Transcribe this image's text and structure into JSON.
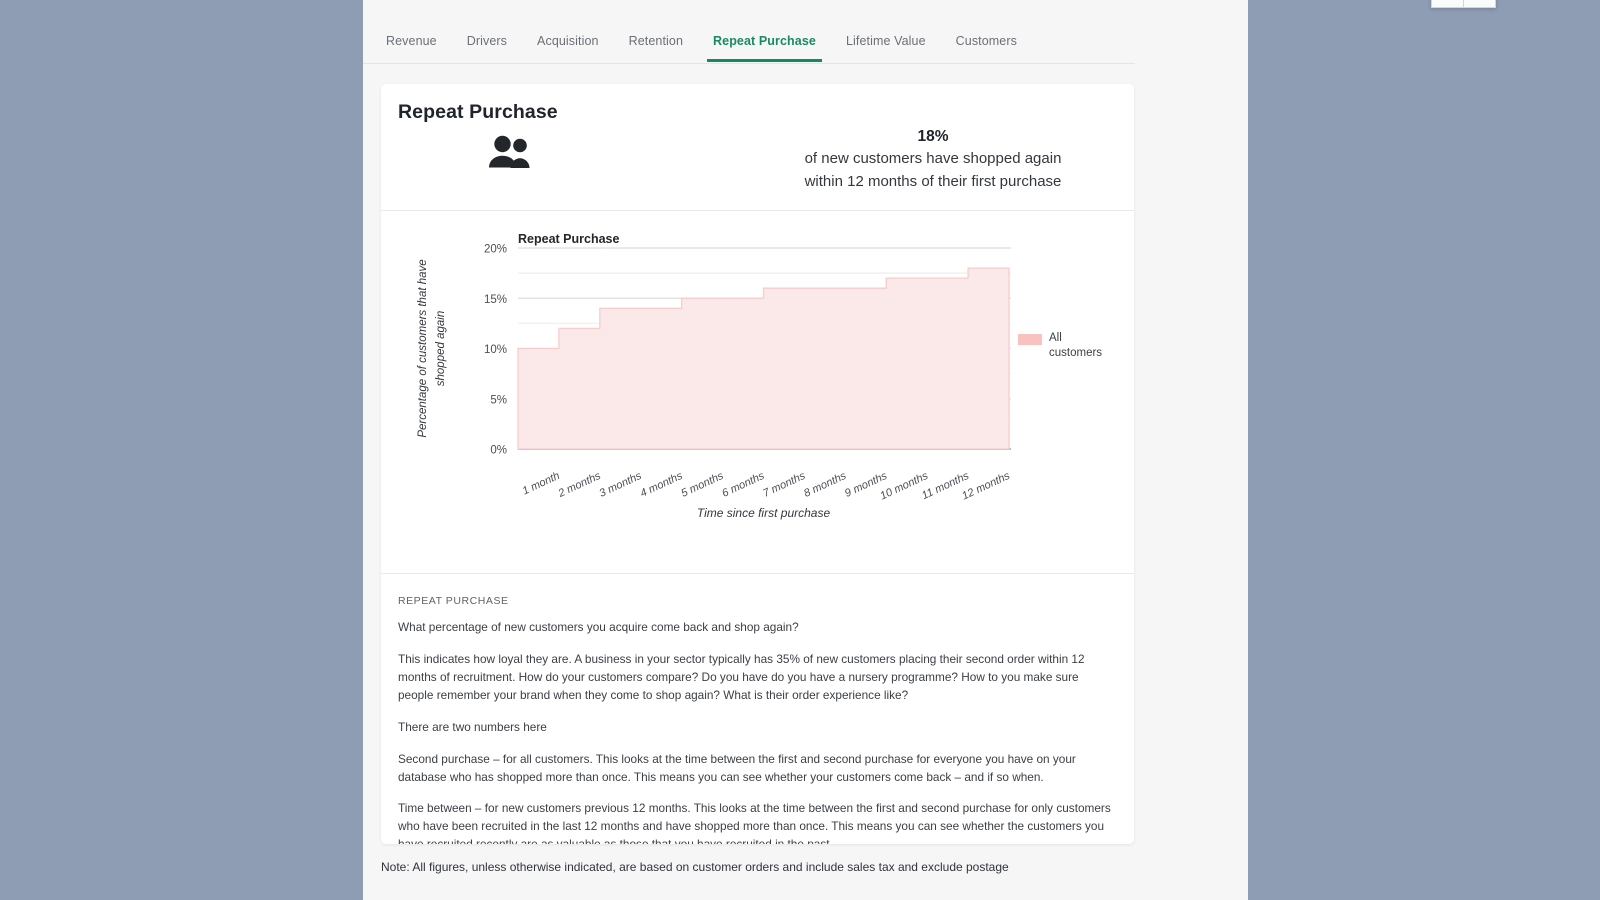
{
  "window": {
    "chrome_buttons": [
      "minimize-restore",
      "close"
    ]
  },
  "tabs": [
    {
      "label": "Revenue",
      "active": false
    },
    {
      "label": "Drivers",
      "active": false
    },
    {
      "label": "Acquisition",
      "active": false
    },
    {
      "label": "Retention",
      "active": false
    },
    {
      "label": "Repeat Purchase",
      "active": true
    },
    {
      "label": "Lifetime Value",
      "active": false
    },
    {
      "label": "Customers",
      "active": false
    }
  ],
  "card": {
    "title": "Repeat Purchase",
    "icon": "people-icon",
    "kpi": {
      "value": "18%",
      "line1": "of new customers have shopped again",
      "line2": "within 12 months of their first purchase"
    }
  },
  "legend": {
    "label_line1": "All",
    "label_line2": "customers",
    "color": "#fac1c1"
  },
  "description": {
    "kicker": "REPEAT PURCHASE",
    "paragraphs": [
      "What percentage of new customers you acquire come back and shop again?",
      "This indicates how loyal they are. A business in your sector typically has 35% of new customers placing their second order within 12 months of recruitment. How do your customers compare? Do you have do you have a nursery programme? How to you make sure people remember your brand when they come to shop again? What is their order experience like?",
      "There are two numbers here",
      "Second purchase – for all customers. This looks at the time between the first and second purchase for everyone you have on your database who has shopped more than once. This means you can see whether your customers come back – and if so when.",
      "Time between – for new customers previous 12 months. This looks at the time between the first and second purchase for only customers who have been recruited in the last 12 months and have shopped more than once. This means you can see whether the customers you have recruited recently are as valuable as those that you have recruited in the past."
    ]
  },
  "footer": {
    "note": "Note: All figures, unless otherwise indicated, are based on customer orders and include sales tax and exclude postage"
  },
  "colors": {
    "accent": "#148a62",
    "series_fill": "#fbe9e9",
    "series_line": "#f6c9c9",
    "page_bg": "#f6f6f7",
    "outer_bg": "#8e9cb4"
  },
  "chart_data": {
    "type": "area",
    "title": "Repeat Purchase",
    "xlabel": "Time since first purchase",
    "ylabel": "Percentage of customers that have shopped again",
    "step": true,
    "categories": [
      "1 month",
      "2 months",
      "3 months",
      "4 months",
      "5 months",
      "6 months",
      "7 months",
      "8 months",
      "9 months",
      "10 months",
      "11 months",
      "12 months"
    ],
    "series": [
      {
        "name": "All customers",
        "color": "#fbe9e9",
        "values": [
          10,
          12,
          14,
          14,
          15,
          15,
          16,
          16,
          16,
          17,
          17,
          18
        ]
      }
    ],
    "ylim": [
      0,
      20
    ],
    "yticks": [
      0,
      5,
      10,
      15,
      20
    ],
    "ytick_labels": [
      "0%",
      "5%",
      "10%",
      "15%",
      "20%"
    ],
    "minor_gridlines": [
      2.5,
      7.5,
      12.5,
      17.5
    ],
    "grid": true,
    "legend_position": "right",
    "xtick_rotation": -25
  }
}
